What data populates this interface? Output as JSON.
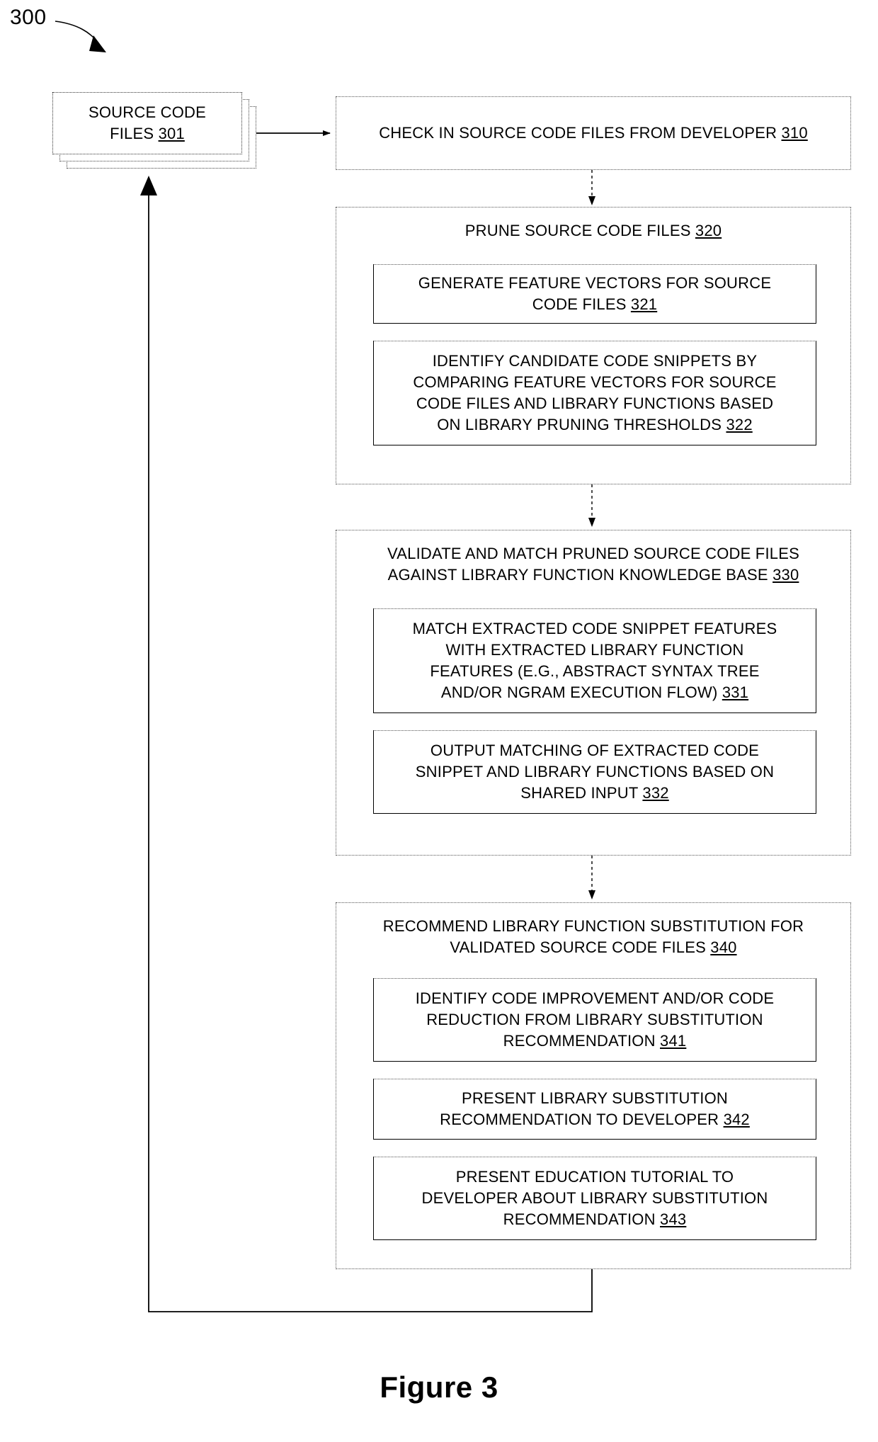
{
  "figure": {
    "ref_number": "300",
    "caption": "Figure 3"
  },
  "nodes": {
    "source_files": {
      "id": "301",
      "line1": "SOURCE CODE",
      "line2": "FILES",
      "full_text": "SOURCE CODE FILES 301",
      "shape": "stacked-document-boxes"
    },
    "step_310": {
      "id": "310",
      "text": "CHECK IN SOURCE CODE FILES FROM DEVELOPER",
      "full_text": "CHECK IN SOURCE CODE FILES FROM DEVELOPER 310"
    },
    "group_320": {
      "id": "320",
      "heading": "PRUNE SOURCE CODE FILES",
      "heading_full": "PRUNE SOURCE CODE FILES 320",
      "children": [
        {
          "id": "321",
          "lines": [
            "GENERATE FEATURE VECTORS FOR SOURCE",
            "CODE FILES"
          ],
          "full_text": "GENERATE FEATURE VECTORS FOR SOURCE CODE FILES 321"
        },
        {
          "id": "322",
          "lines": [
            "IDENTIFY CANDIDATE CODE SNIPPETS BY",
            "COMPARING FEATURE VECTORS FOR SOURCE",
            "CODE FILES AND LIBRARY FUNCTIONS BASED",
            "ON LIBRARY PRUNING THRESHOLDS"
          ],
          "full_text": "IDENTIFY CANDIDATE CODE SNIPPETS BY COMPARING FEATURE VECTORS FOR SOURCE CODE FILES AND LIBRARY FUNCTIONS BASED ON LIBRARY PRUNING THRESHOLDS 322"
        }
      ]
    },
    "group_330": {
      "id": "330",
      "heading_lines": [
        "VALIDATE AND MATCH PRUNED SOURCE CODE FILES",
        "AGAINST LIBRARY FUNCTION KNOWLEDGE BASE"
      ],
      "heading_full": "VALIDATE AND MATCH PRUNED SOURCE CODE FILES AGAINST LIBRARY FUNCTION KNOWLEDGE BASE 330",
      "children": [
        {
          "id": "331",
          "lines": [
            "MATCH EXTRACTED CODE SNIPPET FEATURES",
            "WITH EXTRACTED LIBRARY FUNCTION",
            "FEATURES (E.G., ABSTRACT SYNTAX TREE",
            "AND/OR NGRAM EXECUTION FLOW)"
          ],
          "full_text": "MATCH EXTRACTED CODE SNIPPET FEATURES WITH EXTRACTED LIBRARY FUNCTION FEATURES (E.G., ABSTRACT SYNTAX TREE AND/OR NGRAM EXECUTION FLOW) 331"
        },
        {
          "id": "332",
          "lines": [
            "OUTPUT MATCHING OF EXTRACTED CODE",
            "SNIPPET AND LIBRARY FUNCTIONS BASED ON",
            "SHARED INPUT"
          ],
          "full_text": "OUTPUT MATCHING OF EXTRACTED CODE SNIPPET AND LIBRARY FUNCTIONS BASED ON SHARED INPUT 332"
        }
      ]
    },
    "group_340": {
      "id": "340",
      "heading_lines": [
        "RECOMMEND LIBRARY FUNCTION SUBSTITUTION FOR",
        "VALIDATED SOURCE CODE FILES"
      ],
      "heading_full": "RECOMMEND LIBRARY FUNCTION SUBSTITUTION FOR VALIDATED SOURCE CODE FILES 340",
      "children": [
        {
          "id": "341",
          "lines": [
            "IDENTIFY CODE IMPROVEMENT AND/OR CODE",
            "REDUCTION FROM LIBRARY SUBSTITUTION",
            "RECOMMENDATION"
          ],
          "full_text": "IDENTIFY CODE IMPROVEMENT AND/OR CODE REDUCTION FROM LIBRARY SUBSTITUTION RECOMMENDATION 341"
        },
        {
          "id": "342",
          "lines": [
            "PRESENT LIBRARY SUBSTITUTION",
            "RECOMMENDATION TO DEVELOPER"
          ],
          "full_text": "PRESENT LIBRARY SUBSTITUTION RECOMMENDATION TO DEVELOPER 342"
        },
        {
          "id": "343",
          "lines": [
            "PRESENT EDUCATION TUTORIAL TO",
            "DEVELOPER ABOUT LIBRARY SUBSTITUTION",
            "RECOMMENDATION"
          ],
          "full_text": "PRESENT EDUCATION TUTORIAL TO DEVELOPER ABOUT LIBRARY SUBSTITUTION RECOMMENDATION 343"
        }
      ]
    }
  },
  "connectors": [
    {
      "from": "source_files",
      "to": "step_310",
      "style": "solid-arrow",
      "direction": "right"
    },
    {
      "from": "step_310",
      "to": "group_320",
      "style": "dashed-arrow",
      "direction": "down"
    },
    {
      "from": "group_320",
      "to": "group_330",
      "style": "dashed-arrow",
      "direction": "down"
    },
    {
      "from": "group_330",
      "to": "group_340",
      "style": "dashed-arrow",
      "direction": "down"
    },
    {
      "from": "group_340",
      "to": "source_files",
      "style": "solid-arrow",
      "direction": "feedback-loop-up"
    }
  ],
  "colors": {
    "ink": "#000000",
    "background": "#ffffff",
    "box_border": "#555555"
  }
}
